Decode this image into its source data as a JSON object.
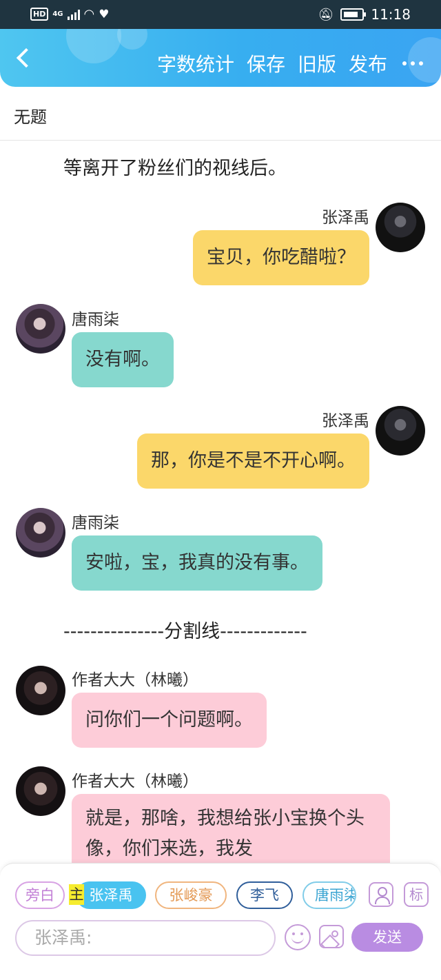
{
  "status_bar": {
    "hd": "HD",
    "network": "4G",
    "time": "11:18"
  },
  "header": {
    "actions": {
      "word_count": "字数统计",
      "save": "保存",
      "old_version": "旧版",
      "publish": "发布"
    }
  },
  "document": {
    "title": "无题"
  },
  "chat": {
    "narration_top": "等离开了粉丝们的视线后。",
    "divider": "---------------分割线-------------",
    "messages": [
      {
        "speaker": "张泽禹",
        "text": "宝贝，你吃醋啦？"
      },
      {
        "speaker": "唐雨柒",
        "text": "没有啊。"
      },
      {
        "speaker": "张泽禹",
        "text": "那，你是不是不开心啊。"
      },
      {
        "speaker": "唐雨柒",
        "text": "安啦，宝，我真的没有事。"
      },
      {
        "speaker": "作者大大（林曦）",
        "text": "问你们一个问题啊。"
      },
      {
        "speaker": "作者大大（林曦）",
        "text": "就是，那啥，我想给张小宝换个头像，你们来选，我发"
      }
    ]
  },
  "composer": {
    "roles": {
      "aside": "旁白",
      "main_marker": "主",
      "zhang_zeyu": "张泽禹",
      "zhang_junhao": "张峻豪",
      "li_fei": "李飞",
      "tang_yuqi": "唐雨柒"
    },
    "tag_label": "标",
    "input_placeholder": "张泽禹:",
    "send_label": "发送"
  }
}
